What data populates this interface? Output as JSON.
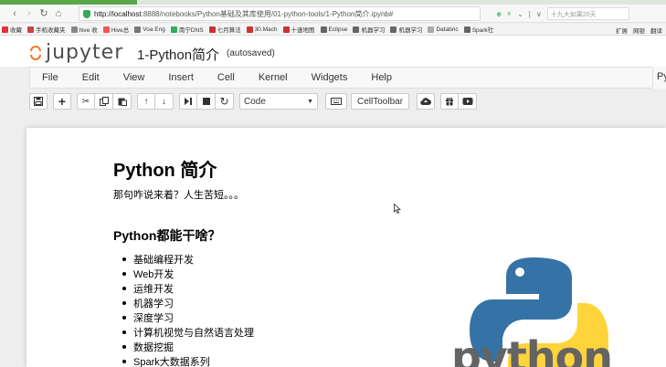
{
  "browser": {
    "url_scheme_host": "http://localhost",
    "url_port_path": ":8888/notebooks/Python基础及其库使用/01-python-tools/1-Python简介.ipynb#",
    "search_hint": "十九大如果20天"
  },
  "bookmarks": {
    "items": [
      "收藏",
      "手机收藏夹",
      "hive 收",
      "Hive总",
      "Voa Eng",
      "南宁DNS",
      "七月算法",
      "30.Mach",
      "十速地图",
      "Eclipse",
      "机器学习",
      "机器学习",
      "Databric",
      "Spark社"
    ],
    "right_items": [
      "扩展",
      "网银",
      "翻译"
    ]
  },
  "header": {
    "logo_text": "jupyter",
    "notebook_title": "1-Python简介",
    "save_status": "(autosaved)"
  },
  "menubar": {
    "items": [
      "File",
      "Edit",
      "View",
      "Insert",
      "Cell",
      "Kernel",
      "Widgets",
      "Help"
    ],
    "kernel_indicator": "Py"
  },
  "toolbar": {
    "cell_type": "Code",
    "celltoolbar_label": "CellToolbar"
  },
  "notebook": {
    "heading1": "Python 简介",
    "paragraph": "那句咋说来着？人生苦短。。。",
    "heading3": "Python都能干啥？",
    "list": [
      "基础编程开发",
      "Web开发",
      "运维开发",
      "机器学习",
      "深度学习",
      "计算机视觉与自然语言处理",
      "数据挖掘",
      "Spark大数据系列"
    ],
    "image_text": "python"
  },
  "colors": {
    "jupyter_orange": "#f37726",
    "python_blue": "#3572a5",
    "python_yellow": "#ffd43b"
  }
}
